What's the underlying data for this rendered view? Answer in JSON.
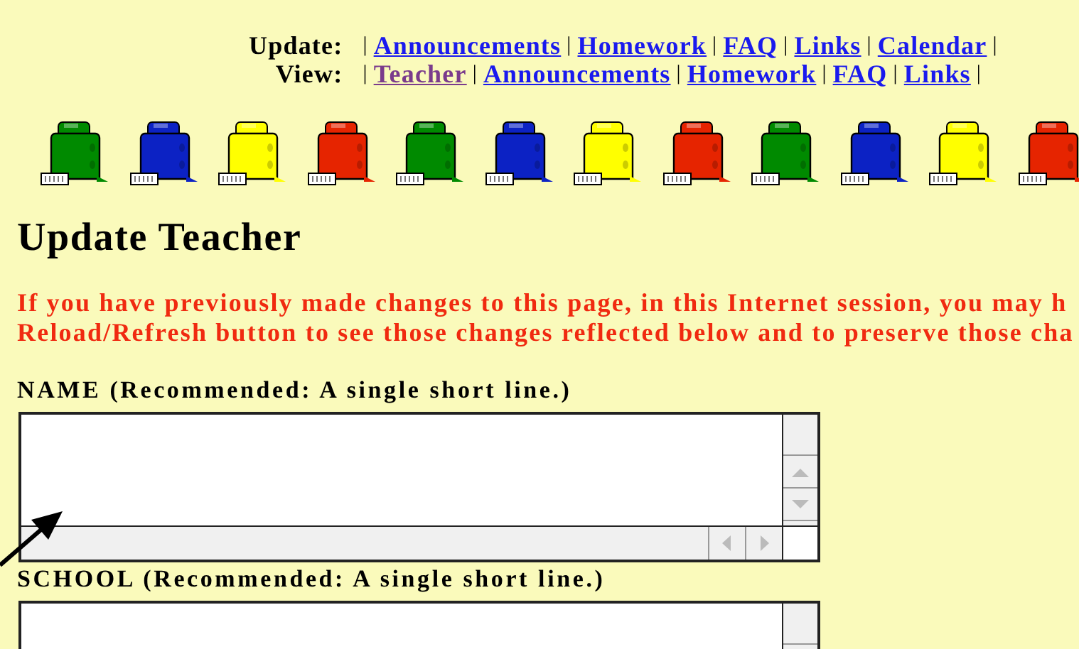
{
  "nav": [
    {
      "label": "Update:",
      "items": [
        {
          "kind": "separator",
          "text": "|"
        },
        {
          "kind": "link",
          "text": "Announcements",
          "visited": false
        },
        {
          "kind": "separator",
          "text": "|"
        },
        {
          "kind": "link",
          "text": "Homework",
          "visited": false
        },
        {
          "kind": "separator",
          "text": "|"
        },
        {
          "kind": "link",
          "text": "FAQ",
          "visited": false
        },
        {
          "kind": "separator",
          "text": "|"
        },
        {
          "kind": "link",
          "text": "Links",
          "visited": false
        },
        {
          "kind": "separator",
          "text": "|"
        },
        {
          "kind": "link",
          "text": "Calendar",
          "visited": false
        },
        {
          "kind": "separator",
          "text": "|"
        }
      ]
    },
    {
      "label": "View:",
      "items": [
        {
          "kind": "separator",
          "text": "|"
        },
        {
          "kind": "link",
          "text": "Teacher",
          "visited": true
        },
        {
          "kind": "separator",
          "text": "|"
        },
        {
          "kind": "link",
          "text": "Announcements",
          "visited": false
        },
        {
          "kind": "separator",
          "text": "|"
        },
        {
          "kind": "link",
          "text": "Homework",
          "visited": false
        },
        {
          "kind": "separator",
          "text": "|"
        },
        {
          "kind": "link",
          "text": "FAQ",
          "visited": false
        },
        {
          "kind": "separator",
          "text": "|"
        },
        {
          "kind": "link",
          "text": "Links",
          "visited": false
        },
        {
          "kind": "separator",
          "text": "|"
        }
      ]
    }
  ],
  "buckets": [
    {
      "color": "#008a00"
    },
    {
      "color": "#0c22c4"
    },
    {
      "color": "#ffff00"
    },
    {
      "color": "#e62400"
    },
    {
      "color": "#008a00"
    },
    {
      "color": "#0c22c4"
    },
    {
      "color": "#ffff00"
    },
    {
      "color": "#e62400"
    },
    {
      "color": "#008a00"
    },
    {
      "color": "#0c22c4"
    },
    {
      "color": "#ffff00"
    },
    {
      "color": "#e62400"
    }
  ],
  "heading": "Update Teacher",
  "notice": [
    "If you have previously made changes to this page, in this Internet session, you may h",
    "Reload/Refresh button to see those changes reflected below and to preserve those cha"
  ],
  "fields": [
    {
      "label": "NAME (Recommended: A single short line.)"
    },
    {
      "label": "SCHOOL (Recommended: A single short line.)"
    }
  ]
}
